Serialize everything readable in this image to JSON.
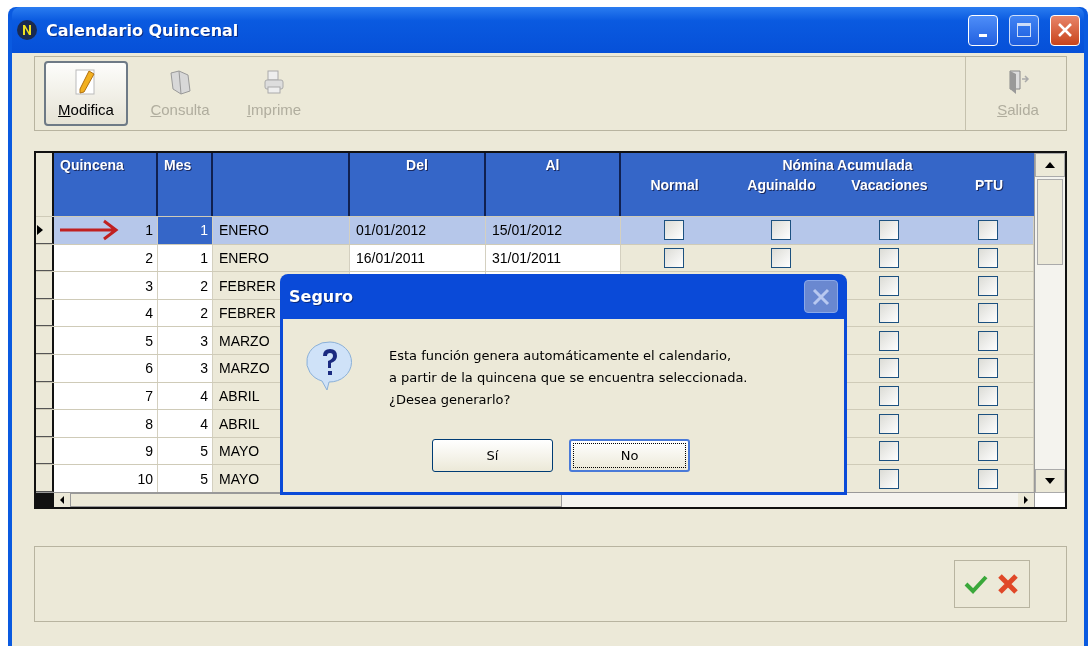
{
  "window": {
    "title": "Calendario Quincenal"
  },
  "toolbar": [
    {
      "label": "Modifica",
      "disabled": false,
      "kind": "edit"
    },
    {
      "label": "Consulta",
      "disabled": true,
      "kind": "view"
    },
    {
      "label": "Imprime",
      "disabled": true,
      "kind": "print"
    }
  ],
  "exit_button": {
    "label": "Salida",
    "disabled": true
  },
  "table": {
    "columns": [
      "Quincena",
      "Mes",
      "Del",
      "Al"
    ],
    "group_header": "Nómina Acumulada",
    "sub_columns": [
      "Normal",
      "Aguinaldo",
      "Vacaciones",
      "PTU"
    ],
    "rows": [
      {
        "quincena": "1",
        "mes": "1",
        "column_3": "ENERO",
        "del": "01/01/2012",
        "al": "15/01/2012",
        "normal": false,
        "aguinaldo": false,
        "vacaciones": false,
        "ptu": false,
        "selected": true
      },
      {
        "quincena": "2",
        "mes": "1",
        "column_3": "ENERO",
        "del": "16/01/2011",
        "al": "31/01/2011",
        "normal": false,
        "aguinaldo": false,
        "vacaciones": false,
        "ptu": false,
        "selected": false
      },
      {
        "quincena": "3",
        "mes": "2",
        "column_3": "FEBRER",
        "vacaciones": false,
        "ptu": false,
        "selected": false
      },
      {
        "quincena": "4",
        "mes": "2",
        "column_3": "FEBRER",
        "vacaciones": false,
        "ptu": false,
        "selected": false
      },
      {
        "quincena": "5",
        "mes": "3",
        "column_3": "MARZO",
        "vacaciones": false,
        "ptu": false,
        "selected": false
      },
      {
        "quincena": "6",
        "mes": "3",
        "column_3": "MARZO",
        "vacaciones": false,
        "ptu": false,
        "selected": false
      },
      {
        "quincena": "7",
        "mes": "4",
        "column_3": "ABRIL",
        "vacaciones": false,
        "ptu": false,
        "selected": false
      },
      {
        "quincena": "8",
        "mes": "4",
        "column_3": "ABRIL",
        "vacaciones": false,
        "ptu": false,
        "selected": false
      },
      {
        "quincena": "9",
        "mes": "5",
        "column_3": "MAYO",
        "vacaciones": false,
        "ptu": false,
        "selected": false
      },
      {
        "quincena": "10",
        "mes": "5",
        "column_3": "MAYO",
        "vacaciones": false,
        "ptu": false,
        "selected": false
      }
    ]
  },
  "dialog": {
    "title": "Seguro",
    "message": "Esta función genera automáticamente el calendario,\na partir de la quincena que se encuentra seleccionada.\n¿Desea generarlo?",
    "buttons": [
      {
        "label": "Sí",
        "selected": false
      },
      {
        "label": "No",
        "selected": true
      }
    ]
  }
}
